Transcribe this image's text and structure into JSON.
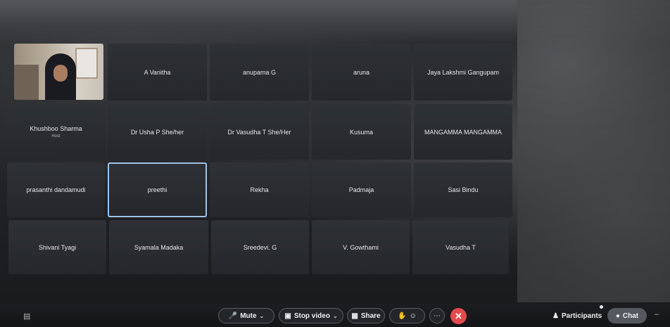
{
  "participants_grid": [
    {
      "name": "A Vanitha",
      "sub": ""
    },
    {
      "name": "anupama G",
      "sub": ""
    },
    {
      "name": "aruna",
      "sub": ""
    },
    {
      "name": "Jaya Lakshmi Gangupam",
      "sub": ""
    },
    {
      "name": "Khushboo Sharma",
      "sub": "Host"
    },
    {
      "name": "Dr Usha P She/her",
      "sub": ""
    },
    {
      "name": "Dr Vasudha T She/Her",
      "sub": ""
    },
    {
      "name": "Kusuma",
      "sub": ""
    },
    {
      "name": "MANGAMMA MANGAMMA",
      "sub": ""
    },
    {
      "name": "prasanthi dandamudi",
      "sub": ""
    },
    {
      "name": "preethi",
      "sub": ""
    },
    {
      "name": "Rekha",
      "sub": ""
    },
    {
      "name": "Padmaja",
      "sub": ""
    },
    {
      "name": "Sasi Bindu",
      "sub": ""
    },
    {
      "name": "Shivani Tyagi",
      "sub": ""
    },
    {
      "name": "Syamala  Madaka",
      "sub": ""
    },
    {
      "name": "Sreedevi. G",
      "sub": ""
    },
    {
      "name": "V. Gowthami",
      "sub": ""
    },
    {
      "name": "Vasudha T",
      "sub": ""
    }
  ],
  "active_speaker": "preethi",
  "toolbar": {
    "mute_label": "Mute",
    "stop_video_label": "Stop video",
    "share_label": "Share",
    "participants_label": "Participants",
    "chat_label": "Chat"
  },
  "icons": {
    "mic": "mic-icon",
    "camera": "video-camera-icon",
    "share": "share-screen-icon",
    "raise_hand": "raise-hand-icon",
    "reactions": "reactions-icon",
    "more": "more-options-icon",
    "end": "end-call-icon",
    "participants": "participants-icon",
    "chat": "chat-icon",
    "captions": "captions-icon"
  },
  "colors": {
    "active_outline": "#9fc2e8",
    "end_call": "#e5484d"
  }
}
